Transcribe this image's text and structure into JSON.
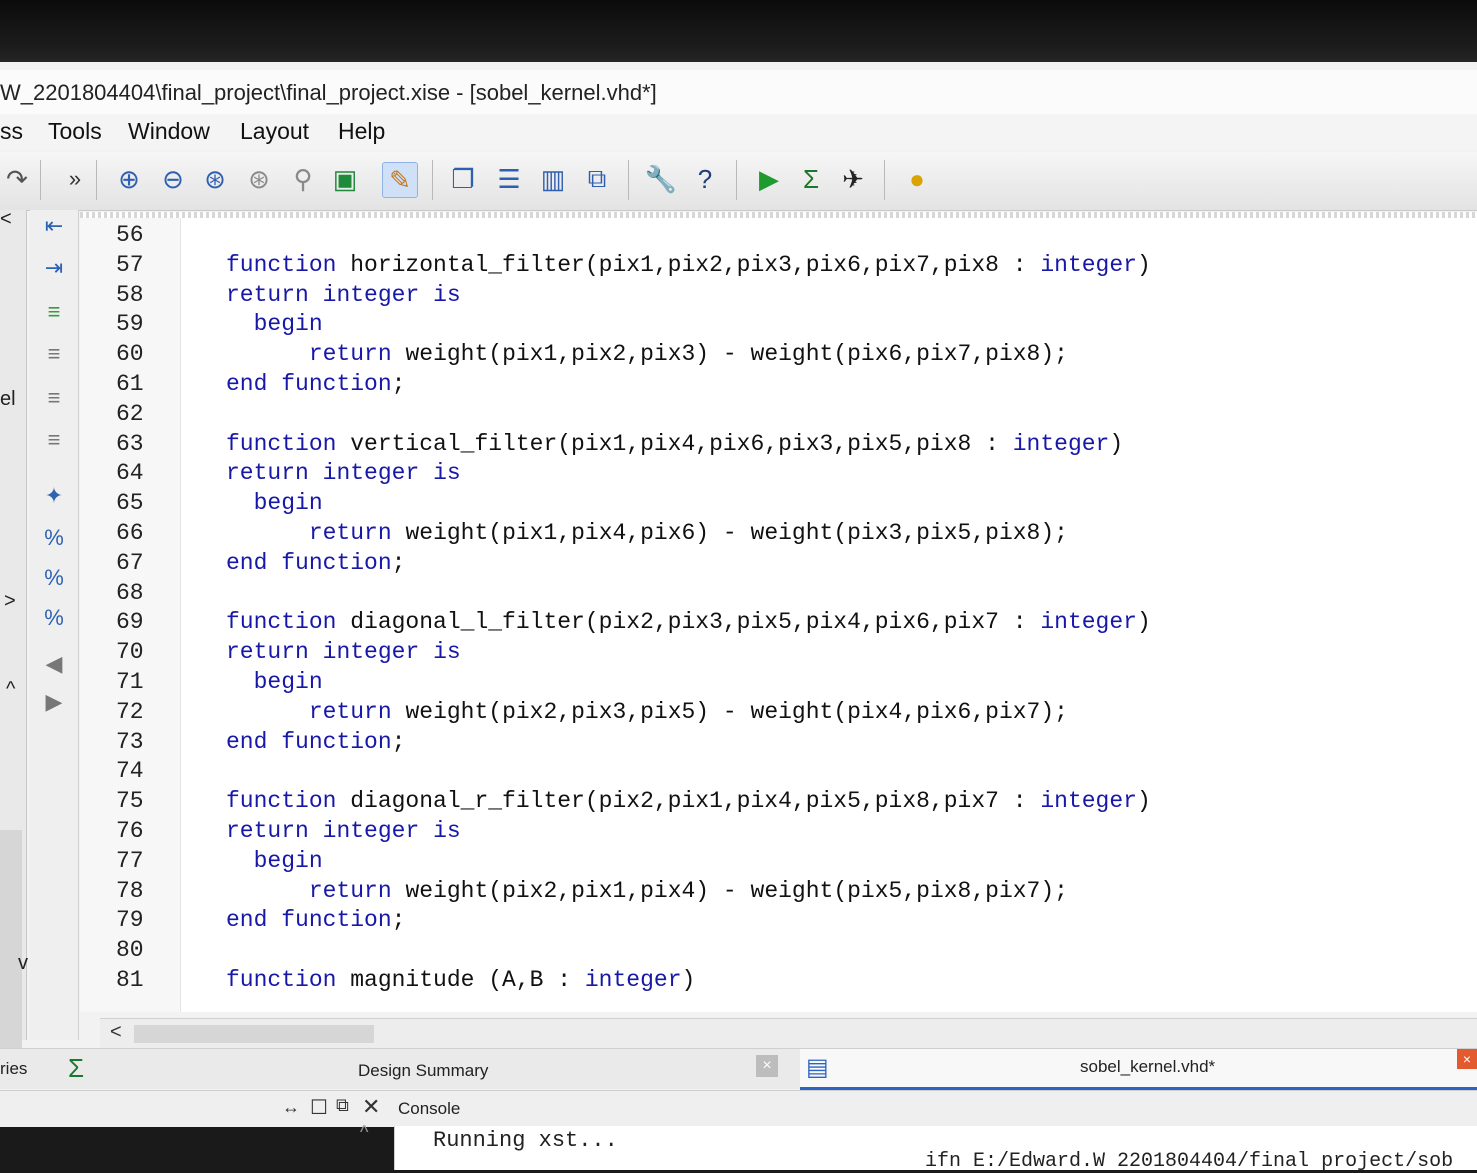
{
  "window": {
    "title": "W_2201804404\\final_project\\final_project.xise - [sobel_kernel.vhd*]"
  },
  "menu": {
    "items": [
      "ss",
      "Tools",
      "Window",
      "Layout",
      "Help"
    ]
  },
  "toolbar": {
    "overflow_label": "»",
    "icons": [
      "redo-icon",
      "zoom-in-icon",
      "zoom-out-icon",
      "zoom-fit-icon",
      "zoom-full-icon",
      "pin-icon",
      "refresh-icon",
      "pen-icon",
      "cascade-icon",
      "tile-horizontal-icon",
      "tile-vertical-icon",
      "float-icon",
      "wrench-icon",
      "help-cursor-icon",
      "run-icon",
      "sigma-icon",
      "pin2-icon",
      "lightbulb-icon"
    ]
  },
  "left": {
    "label_el": "el",
    "arrow_right": ">",
    "arrow_left": "<",
    "arrow_up": "^",
    "arrow_down": "v",
    "bottom_label": "ries"
  },
  "editor": {
    "lines": [
      {
        "n": "56",
        "t": ""
      },
      {
        "n": "57",
        "t": "function horizontal_filter(pix1,pix2,pix3,pix6,pix7,pix8 : integer)"
      },
      {
        "n": "58",
        "t": "return integer is"
      },
      {
        "n": "59",
        "t": "  begin"
      },
      {
        "n": "60",
        "t": "      return weight(pix1,pix2,pix3) - weight(pix6,pix7,pix8);"
      },
      {
        "n": "61",
        "t": "end function;"
      },
      {
        "n": "62",
        "t": ""
      },
      {
        "n": "63",
        "t": "function vertical_filter(pix1,pix4,pix6,pix3,pix5,pix8 : integer)"
      },
      {
        "n": "64",
        "t": "return integer is"
      },
      {
        "n": "65",
        "t": "  begin"
      },
      {
        "n": "66",
        "t": "      return weight(pix1,pix4,pix6) - weight(pix3,pix5,pix8);"
      },
      {
        "n": "67",
        "t": "end function;"
      },
      {
        "n": "68",
        "t": ""
      },
      {
        "n": "69",
        "t": "function diagonal_l_filter(pix2,pix3,pix5,pix4,pix6,pix7 : integer)"
      },
      {
        "n": "70",
        "t": "return integer is"
      },
      {
        "n": "71",
        "t": "  begin"
      },
      {
        "n": "72",
        "t": "      return weight(pix2,pix3,pix5) - weight(pix4,pix6,pix7);"
      },
      {
        "n": "73",
        "t": "end function;"
      },
      {
        "n": "74",
        "t": ""
      },
      {
        "n": "75",
        "t": "function diagonal_r_filter(pix2,pix1,pix4,pix5,pix8,pix7 : integer)"
      },
      {
        "n": "76",
        "t": "return integer is"
      },
      {
        "n": "77",
        "t": "  begin"
      },
      {
        "n": "78",
        "t": "      return weight(pix2,pix1,pix4) - weight(pix5,pix8,pix7);"
      },
      {
        "n": "79",
        "t": "end function;"
      },
      {
        "n": "80",
        "t": ""
      },
      {
        "n": "81",
        "t": "function magnitude (A,B : integer)"
      }
    ]
  },
  "tabs": {
    "design_summary": "Design Summary",
    "active_file": "sobel_kernel.vhd*"
  },
  "console": {
    "title": "Console",
    "line1": "Running xst...",
    "line2": "ifn E:/Edward.W 2201804404/final project/sob"
  },
  "colors": {
    "keyword": "#1818a8",
    "accent": "#2d64c4"
  }
}
